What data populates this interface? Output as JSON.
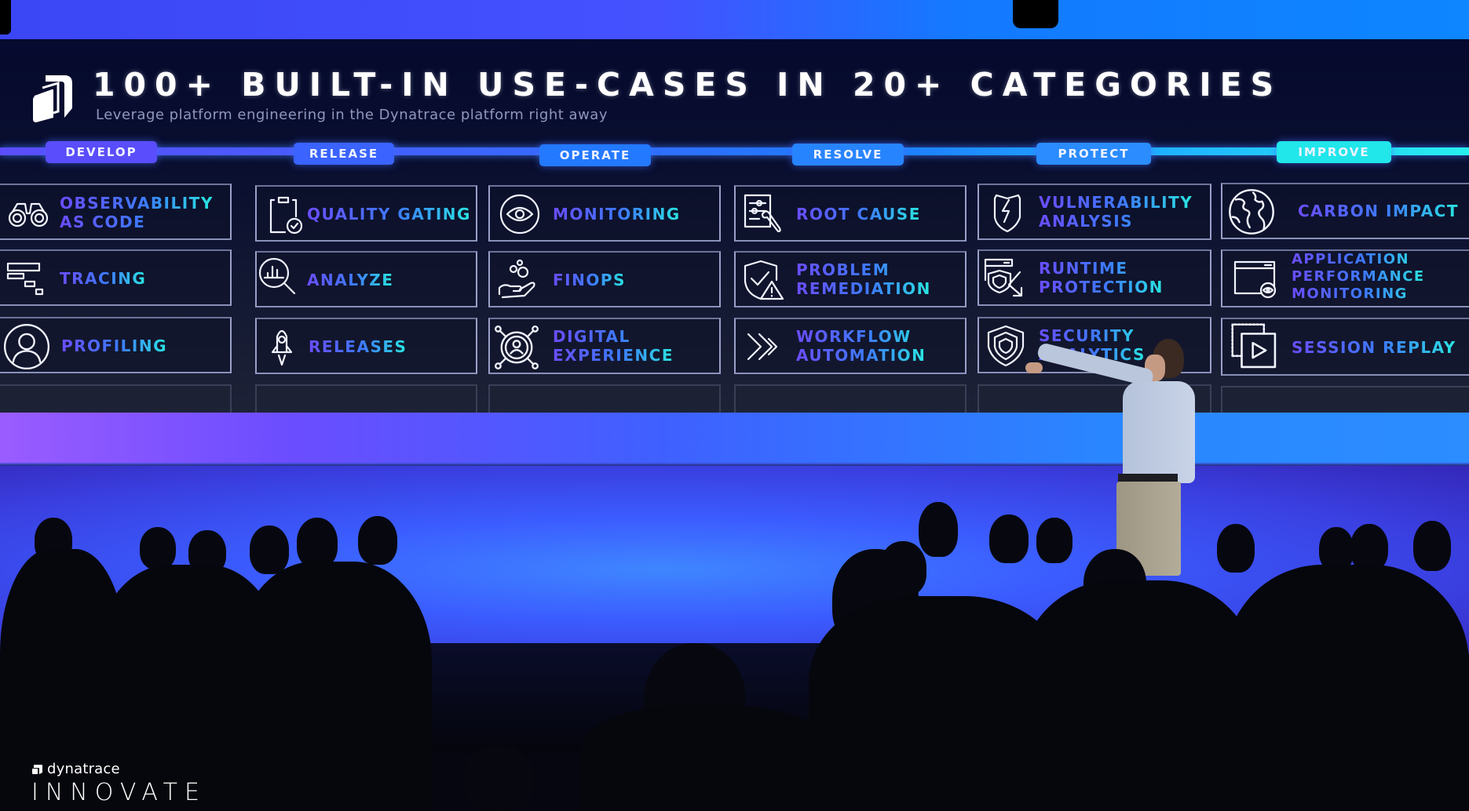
{
  "slide": {
    "title": "100+ BUILT-IN USE-CASES IN 20+ CATEGORIES",
    "subtitle": "Leverage platform engineering in the Dynatrace platform right away",
    "logo_icon": "dynatrace-logo-icon"
  },
  "categories": [
    {
      "name": "DEVELOP",
      "color": "#5a4dfc",
      "items": [
        {
          "label": "OBSERVABILITY\nAS CODE",
          "icon": "binoculars-icon"
        },
        {
          "label": "TRACING",
          "icon": "trace-waterfall-icon"
        },
        {
          "label": "PROFILING",
          "icon": "user-profile-icon"
        }
      ]
    },
    {
      "name": "RELEASE",
      "color": "#3a63ff",
      "items": [
        {
          "label": "QUALITY GATING",
          "icon": "clipboard-check-icon"
        },
        {
          "label": "ANALYZE",
          "icon": "magnifier-chart-icon"
        },
        {
          "label": "RELEASES",
          "icon": "rocket-icon"
        }
      ]
    },
    {
      "name": "OPERATE",
      "color": "#2379ff",
      "items": [
        {
          "label": "MONITORING",
          "icon": "eye-icon"
        },
        {
          "label": "FINOPS",
          "icon": "hand-coins-icon"
        },
        {
          "label": "DIGITAL\nEXPERIENCE",
          "icon": "user-network-icon"
        }
      ]
    },
    {
      "name": "RESOLVE",
      "color": "#2784ff",
      "items": [
        {
          "label": "ROOT CAUSE",
          "icon": "document-wrench-icon"
        },
        {
          "label": "PROBLEM\nREMEDIATION",
          "icon": "shield-warning-icon"
        },
        {
          "label": "WORKFLOW\nAUTOMATION",
          "icon": "chevrons-icon"
        }
      ]
    },
    {
      "name": "PROTECT",
      "color": "#2a8cff",
      "items": [
        {
          "label": "VULNERABILITY\nANALYSIS",
          "icon": "broken-shield-icon"
        },
        {
          "label": "RUNTIME\nPROTECTION",
          "icon": "window-shield-icon"
        },
        {
          "label": "SECURITY\nANALYTICS",
          "icon": "double-shield-icon"
        }
      ]
    },
    {
      "name": "IMPROVE",
      "color": "#21e6ea",
      "items": [
        {
          "label": "CARBON IMPACT",
          "icon": "globe-icon"
        },
        {
          "label": "APPLICATION\nPERFORMANCE\nMONITORING",
          "icon": "browser-eye-icon"
        },
        {
          "label": "SESSION REPLAY",
          "icon": "play-window-icon"
        }
      ]
    }
  ],
  "event_branding": {
    "company": "dynatrace",
    "event": "INNOVATE"
  }
}
